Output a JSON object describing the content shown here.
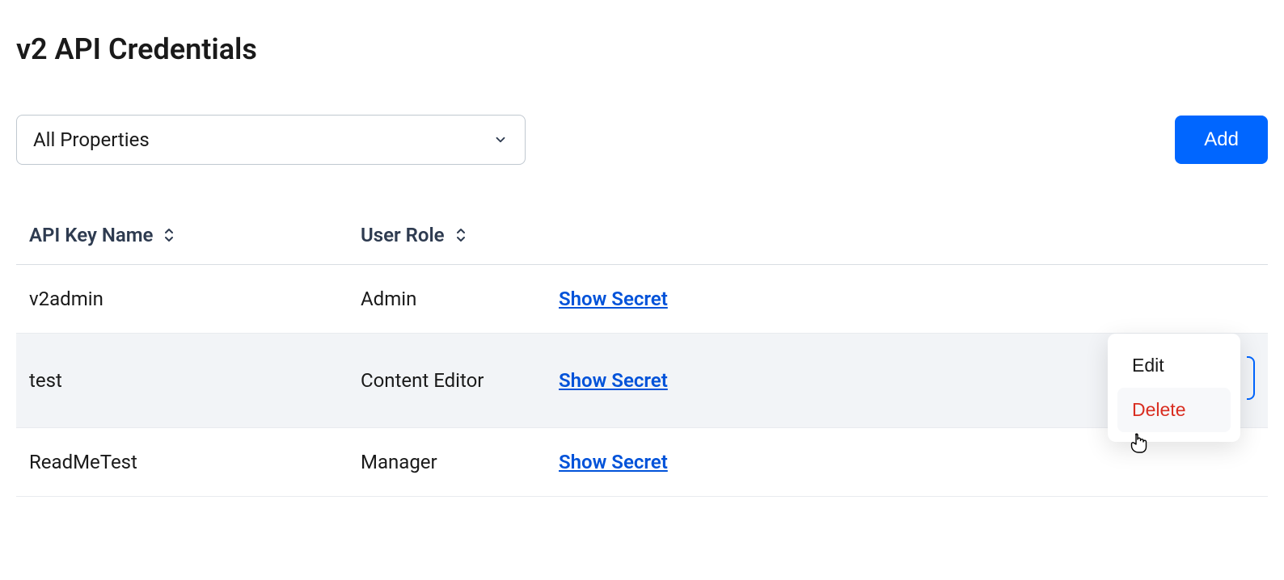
{
  "page": {
    "title": "v2 API Credentials"
  },
  "toolbar": {
    "dropdown_value": "All Properties",
    "add_label": "Add"
  },
  "table": {
    "headers": {
      "name": "API Key Name",
      "role": "User Role"
    },
    "rows": [
      {
        "name": "v2admin",
        "role": "Admin",
        "secret_label": "Show Secret"
      },
      {
        "name": "test",
        "role": "Content Editor",
        "secret_label": "Show Secret"
      },
      {
        "name": "ReadMeTest",
        "role": "Manager",
        "secret_label": "Show Secret"
      }
    ]
  },
  "popover": {
    "edit_label": "Edit",
    "delete_label": "Delete"
  }
}
